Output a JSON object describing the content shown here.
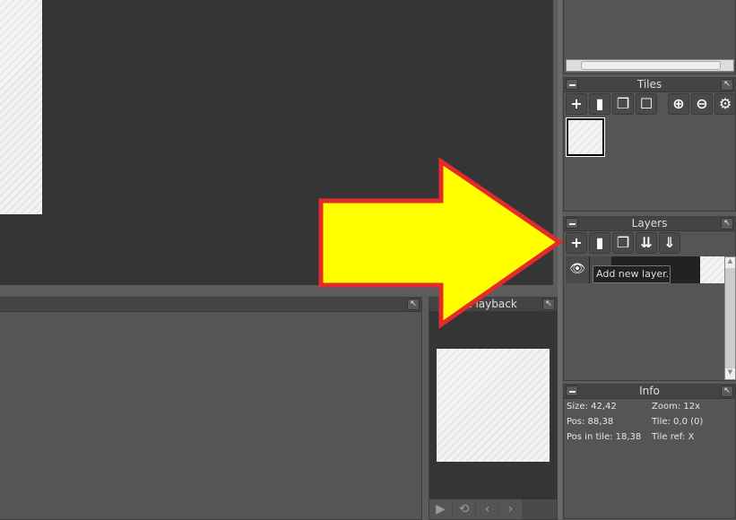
{
  "tiles": {
    "title": "Tiles",
    "toolbar": [
      {
        "icon": "plus-icon",
        "glyph": "+"
      },
      {
        "icon": "trash-icon",
        "glyph": "▮"
      },
      {
        "icon": "copy-icon",
        "glyph": "❐"
      },
      {
        "icon": "clear-tile-icon",
        "glyph": "☐"
      },
      {
        "icon": "zoom-in-icon",
        "glyph": "⊕"
      },
      {
        "icon": "zoom-out-icon",
        "glyph": "⊖"
      },
      {
        "icon": "gear-icon",
        "glyph": "⚙"
      }
    ]
  },
  "layers": {
    "title": "Layers",
    "toolbar": [
      {
        "icon": "plus-icon",
        "glyph": "+"
      },
      {
        "icon": "trash-icon",
        "glyph": "▮"
      },
      {
        "icon": "copy-icon",
        "glyph": "❐"
      },
      {
        "icon": "merge-down-icon",
        "glyph": "⇊"
      },
      {
        "icon": "move-down-icon",
        "glyph": "⇓"
      }
    ],
    "tooltip": "Add new layer."
  },
  "info": {
    "title": "Info",
    "size": "Size: 42,42",
    "zoom": "Zoom: 12x",
    "pos": "Pos: 88,38",
    "tile": "Tile: 0,0 (0)",
    "pos_in_tile": "Pos in tile: 18,38",
    "tile_ref": "Tile ref: X"
  },
  "playback": {
    "title": "Playback",
    "controls": [
      {
        "icon": "play-icon",
        "glyph": "▶"
      },
      {
        "icon": "loop-icon",
        "glyph": "⟲"
      },
      {
        "icon": "prev-frame-icon",
        "glyph": "‹"
      },
      {
        "icon": "next-frame-icon",
        "glyph": "›"
      }
    ]
  },
  "colors": {
    "arrow_fill": "#ffff00",
    "arrow_stroke": "#e52a2a",
    "canvas": "#353535"
  }
}
